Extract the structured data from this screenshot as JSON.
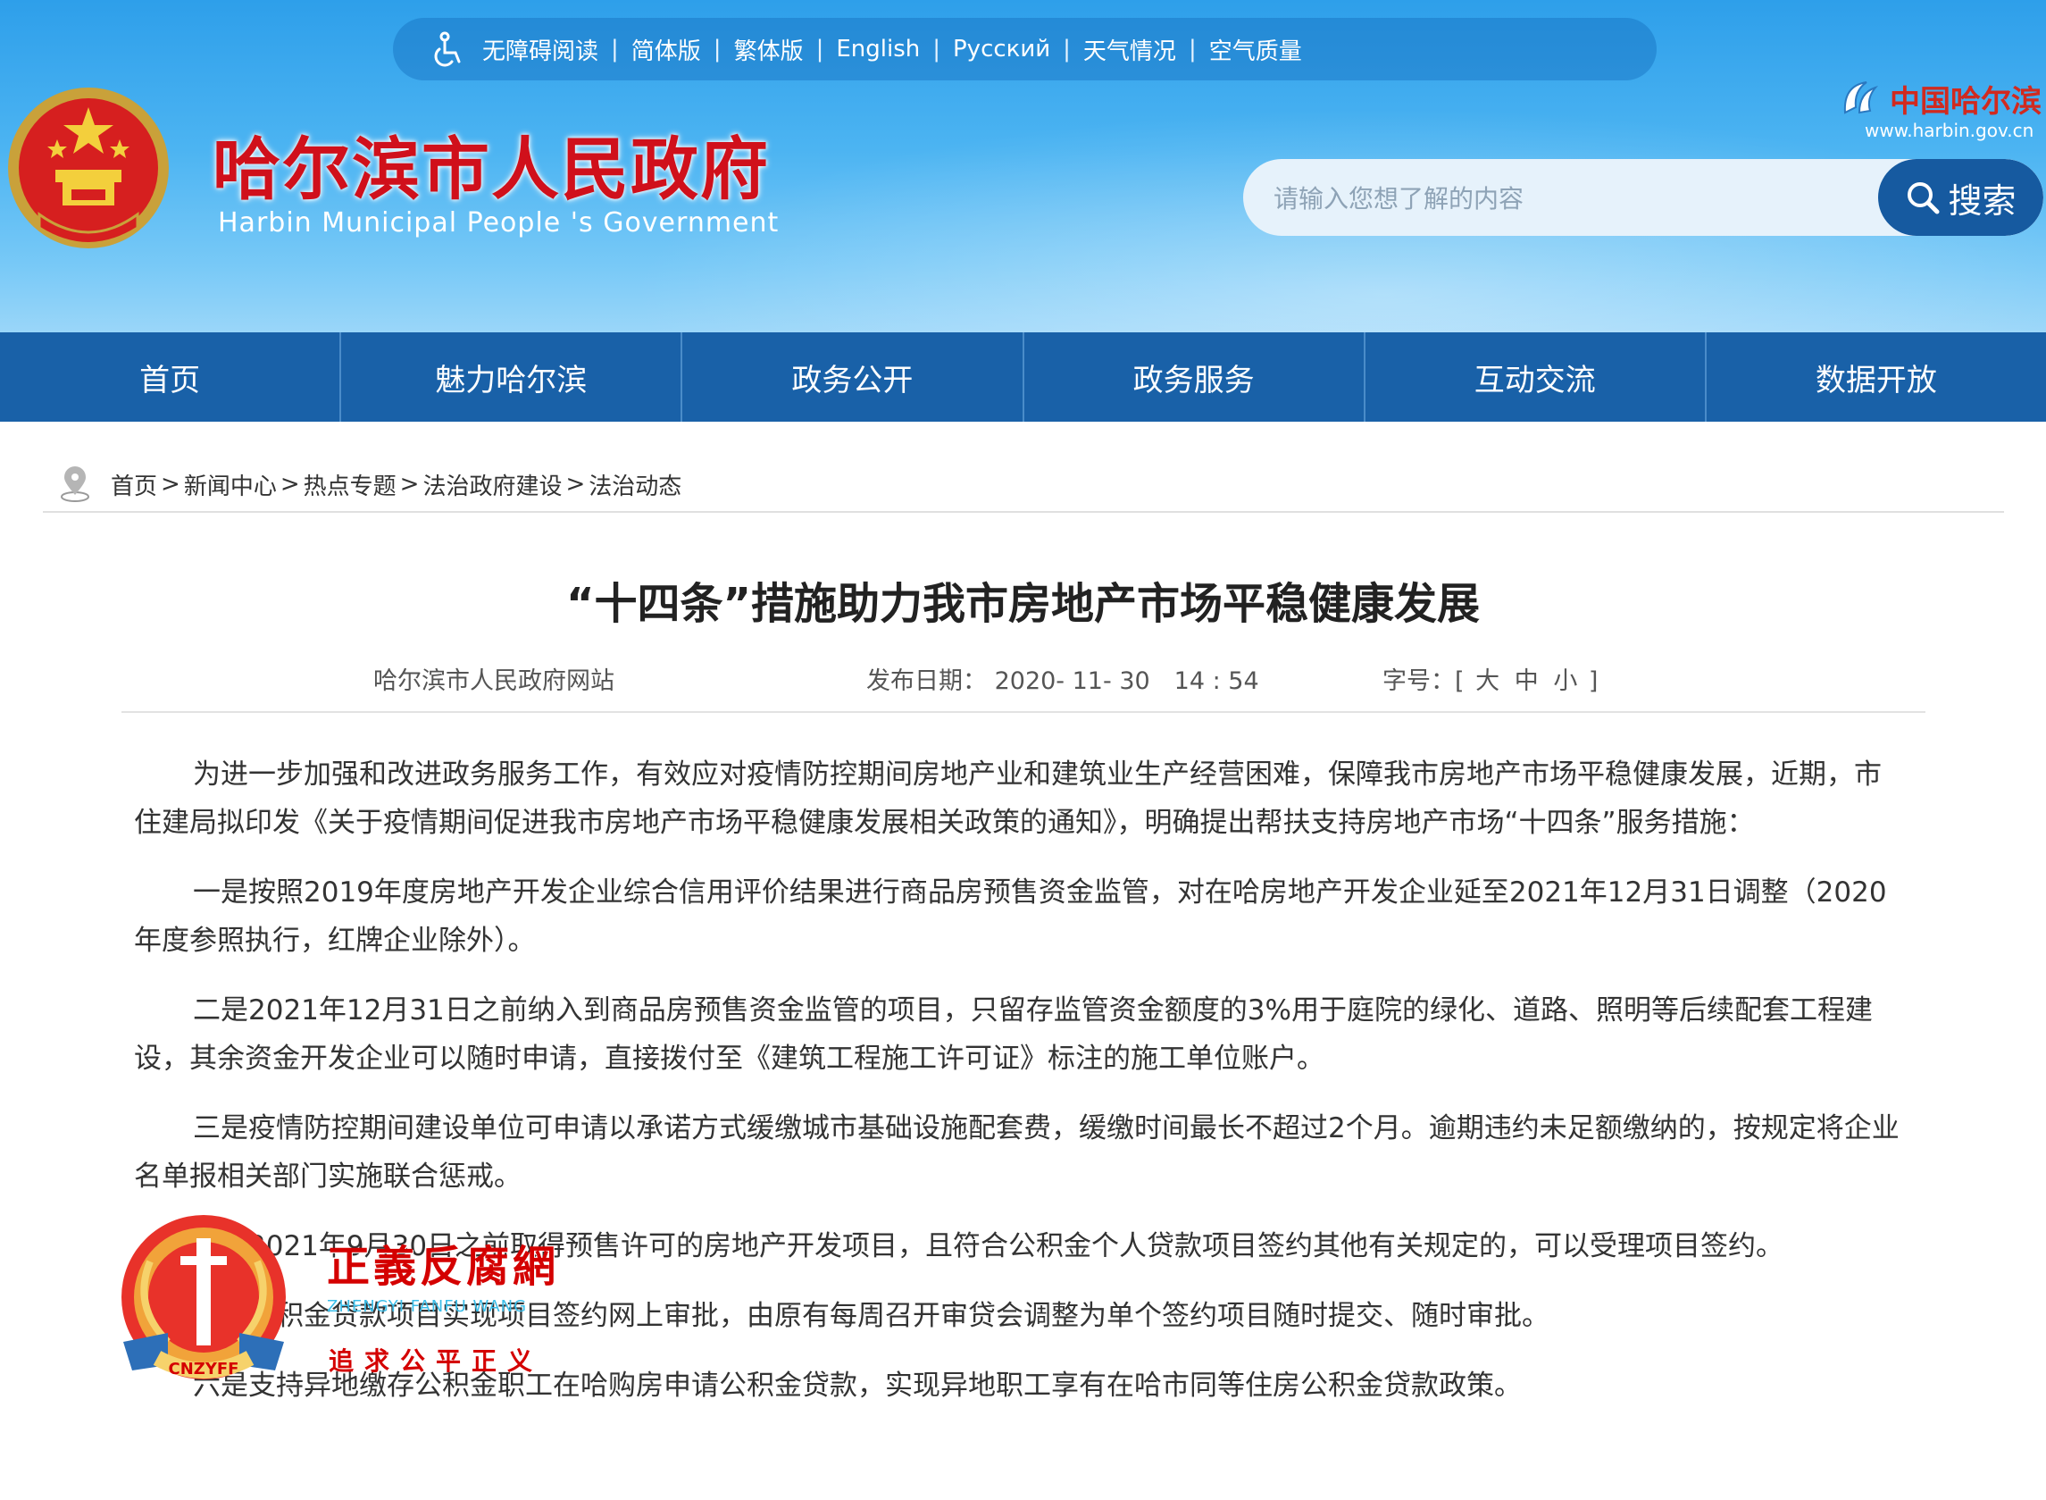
{
  "topbar": {
    "items": [
      "无障碍阅读",
      "简体版",
      "繁体版",
      "English",
      "Русский",
      "天气情况",
      "空气质量"
    ]
  },
  "header": {
    "title": "哈尔滨市人民政府",
    "subtitle": "Harbin Municipal People 's Government",
    "side_logo": "中国哈尔滨",
    "side_url": "www.harbin.gov.cn"
  },
  "search": {
    "placeholder": "请输入您想了解的内容",
    "button_label": "搜索"
  },
  "nav": {
    "items": [
      "首页",
      "魅力哈尔滨",
      "政务公开",
      "政务服务",
      "互动交流",
      "数据开放"
    ]
  },
  "breadcrumb": {
    "items": [
      "首页",
      "新闻中心",
      "热点专题",
      "法治政府建设",
      "法治动态"
    ],
    "separator": ">"
  },
  "article": {
    "title": "“十四条”措施助力我市房地产市场平稳健康发展",
    "source": "哈尔滨市人民政府网站",
    "date_label": "发布日期：",
    "date": "2020- 11- 30　14 : 54",
    "font_label": "字号：[",
    "font_sizes": [
      "大",
      "中",
      "小"
    ],
    "font_close": "]",
    "paragraphs": [
      "为进一步加强和改进政务服务工作，有效应对疫情防控期间房地产业和建筑业生产经营困难，保障我市房地产市场平稳健康发展，近期，市住建局拟印发《关于疫情期间促进我市房地产市场平稳健康发展相关政策的通知》，明确提出帮扶支持房地产市场“十四条”服务措施：",
      "一是按照2019年度房地产开发企业综合信用评价结果进行商品房预售资金监管，对在哈房地产开发企业延至2021年12月31日调整（2020年度参照执行，红牌企业除外）。",
      "二是2021年12月31日之前纳入到商品房预售资金监管的项目，只留存监管资金额度的3%用于庭院的绿化、道路、照明等后续配套工程建设，其余资金开发企业可以随时申请，直接拨付至《建筑工程施工许可证》标注的施工单位账户。",
      "三是疫情防控期间建设单位可申请以承诺方式缓缴城市基础设施配套费，缓缴时间最长不超过2个月。逾期违约未足额缴纳的，按规定将企业名单报相关部门实施联合惩戒。",
      "四是2021年9月30日之前取得预售许可的房地产开发项目，且符合公积金个人贷款项目签约其他有关规定的，可以受理项目签约。",
      "五是公积金贷款项目实现项目签约网上审批，由原有每周召开审贷会调整为单个签约项目随时提交、随时审批。",
      "六是支持异地缴存公积金职工在哈购房申请公积金贷款，实现异地职工享有在哈市同等住房公积金贷款政策。"
    ]
  },
  "watermark": {
    "title": "正義反腐網",
    "pinyin": "ZHENGYI FANFU WANG",
    "slogan": "追求公平正义",
    "badge_text": "CNZYFF"
  },
  "colors": {
    "header_blue": "#2e9fea",
    "nav_blue": "#1961a8",
    "title_red": "#d0101b",
    "search_button": "#165aa0"
  }
}
